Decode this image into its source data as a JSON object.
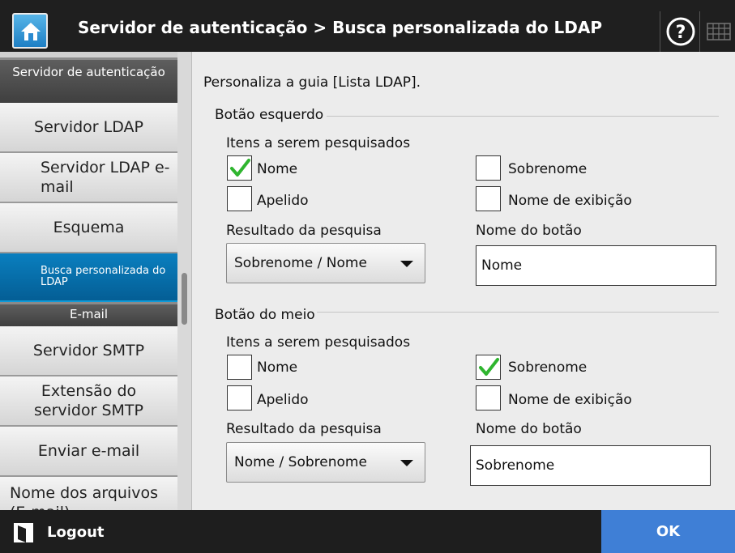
{
  "header": {
    "title": "Servidor de autenticação > Busca personalizada do LDAP"
  },
  "sidebar": {
    "categories": [
      {
        "label": "Servidor de autenticação"
      },
      {
        "label": "E-mail"
      }
    ],
    "items": [
      {
        "label": "Servidor LDAP"
      },
      {
        "label": "Servidor LDAP e-mail"
      },
      {
        "label": "Esquema"
      },
      {
        "label": "Busca personalizada do LDAP"
      },
      {
        "label": "Servidor SMTP"
      },
      {
        "label": "Extensão do servidor SMTP"
      },
      {
        "label": "Enviar e-mail"
      },
      {
        "label": "Nome dos arquivos (E-mail)"
      }
    ]
  },
  "main": {
    "description": "Personaliza a guia [Lista LDAP].",
    "sections": [
      {
        "title": "Botão esquerdo",
        "items_label": "Itens a serem pesquisados",
        "checkboxes": [
          {
            "label": "Nome",
            "checked": true
          },
          {
            "label": "Sobrenome",
            "checked": false
          },
          {
            "label": "Apelido",
            "checked": false
          },
          {
            "label": "Nome de exibição",
            "checked": false
          }
        ],
        "result_label": "Resultado da pesquisa",
        "result_value": "Sobrenome / Nome",
        "button_name_label": "Nome do botão",
        "button_name_value": "Nome"
      },
      {
        "title": "Botão do meio",
        "items_label": "Itens a serem pesquisados",
        "checkboxes": [
          {
            "label": "Nome",
            "checked": false
          },
          {
            "label": "Sobrenome",
            "checked": true
          },
          {
            "label": "Apelido",
            "checked": false
          },
          {
            "label": "Nome de exibição",
            "checked": false
          }
        ],
        "result_label": "Resultado da pesquisa",
        "result_value": "Nome / Sobrenome",
        "button_name_label": "Nome do botão",
        "button_name_value": "Sobrenome"
      }
    ]
  },
  "footer": {
    "logout_label": "Logout",
    "ok_label": "OK"
  },
  "colors": {
    "accent": "#0a7fbf",
    "ok_button": "#3f7fd6",
    "check": "#2fb52f"
  },
  "icons": [
    "home-icon",
    "help-icon",
    "keyboard-icon",
    "logout-icon",
    "checkmark-icon",
    "dropdown-arrow-icon"
  ]
}
